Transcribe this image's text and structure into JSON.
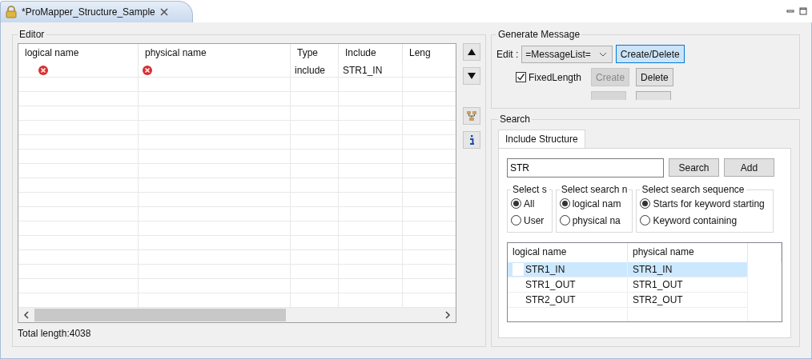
{
  "tab": {
    "title": "*ProMapper_Structure_Sample"
  },
  "editor": {
    "title": "Editor",
    "columns": [
      "logical name",
      "physical name",
      "Type",
      "Include",
      "Leng"
    ],
    "rows": [
      {
        "logical_error": true,
        "physical_error": true,
        "type": "include",
        "include": "STR1_IN"
      }
    ],
    "total_length": "Total length:4038"
  },
  "generate": {
    "title": "Generate Message",
    "edit_label": "Edit :",
    "message_list": "=MessageList=",
    "create_delete": "Create/Delete",
    "fixed_length": {
      "label": "FixedLength",
      "checked": true
    },
    "create": {
      "label": "Create",
      "disabled": true
    },
    "delete": {
      "label": "Delete",
      "disabled": false
    }
  },
  "search": {
    "title": "Search",
    "tab": "Include Structure",
    "query": "STR",
    "search_button": "Search",
    "add_button": "Add",
    "groups": [
      {
        "title": "Select s",
        "options": [
          {
            "label": "All",
            "selected": true
          },
          {
            "label": "User",
            "selected": false
          }
        ]
      },
      {
        "title": "Select search n",
        "options": [
          {
            "label": "logical nam",
            "selected": true
          },
          {
            "label": "physical na",
            "selected": false
          }
        ]
      },
      {
        "title": "Select search sequence",
        "options": [
          {
            "label": "Starts for keyword starting",
            "selected": true
          },
          {
            "label": "Keyword containing",
            "selected": false
          }
        ]
      }
    ],
    "columns": [
      "logical name",
      "physical name"
    ],
    "rows": [
      {
        "logical": "STR1_IN",
        "physical": "STR1_IN",
        "selected": true
      },
      {
        "logical": "STR1_OUT",
        "physical": "STR1_OUT",
        "selected": false
      },
      {
        "logical": "STR2_OUT",
        "physical": "STR2_OUT",
        "selected": false
      }
    ]
  }
}
